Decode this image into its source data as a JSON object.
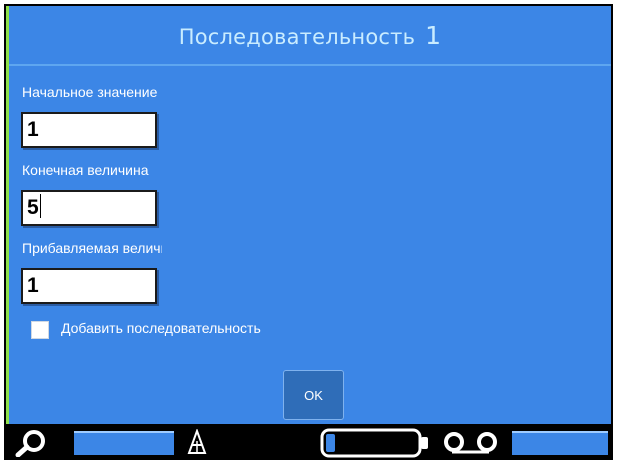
{
  "dialog": {
    "title": "Последовательность",
    "title_number": "1",
    "fields": [
      {
        "label": "Начальное значение",
        "value": "1"
      },
      {
        "label": "Конечная величина",
        "value": "5"
      },
      {
        "label": "Прибавляемая величина",
        "value": "1"
      }
    ],
    "checkbox": {
      "label": "Добавить последовательность",
      "checked": false
    },
    "ok_label": "OK"
  },
  "status_bar": {
    "icons": [
      "search-icon",
      "font-size-icon",
      "battery-icon",
      "tape-icon"
    ],
    "battery_level": 0.1
  },
  "colors": {
    "background": "#3c86e6",
    "title_text": "#c9ecff",
    "border_accent": "#8ee04a"
  }
}
